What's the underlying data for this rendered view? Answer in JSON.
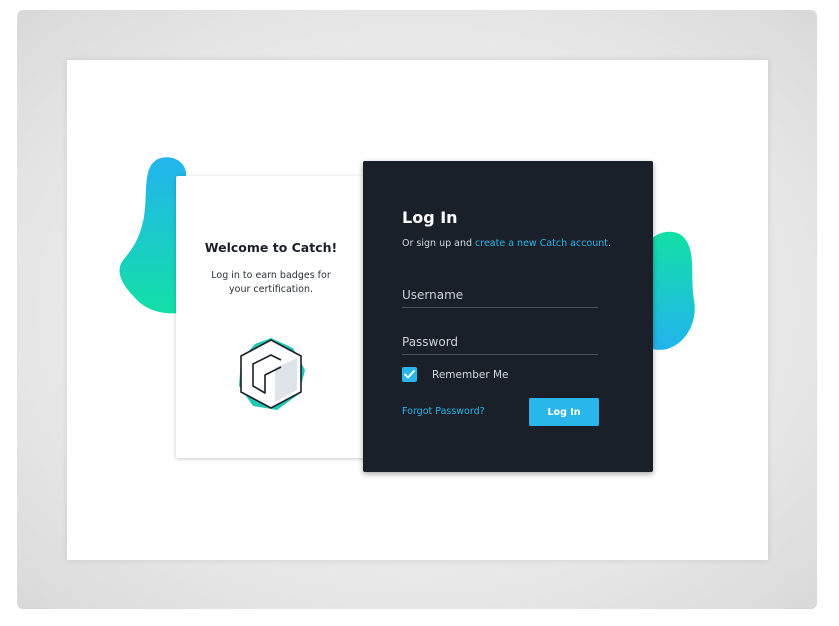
{
  "welcome": {
    "title": "Welcome to Catch!",
    "subtitle": "Log in to earn badges for your certification."
  },
  "login": {
    "title": "Log In",
    "subtitle_prefix": "Or sign up and ",
    "subtitle_link": "create a new Catch account",
    "subtitle_suffix": ".",
    "username_placeholder": "Username",
    "password_placeholder": "Password",
    "remember_label": "Remember Me",
    "remember_checked": true,
    "forgot_label": "Forgot Password?",
    "submit_label": "Log In"
  },
  "colors": {
    "accent": "#29b6ea",
    "panel": "#19202a",
    "blob_teal": "#12e0a6",
    "blob_blue": "#23b4ee"
  }
}
